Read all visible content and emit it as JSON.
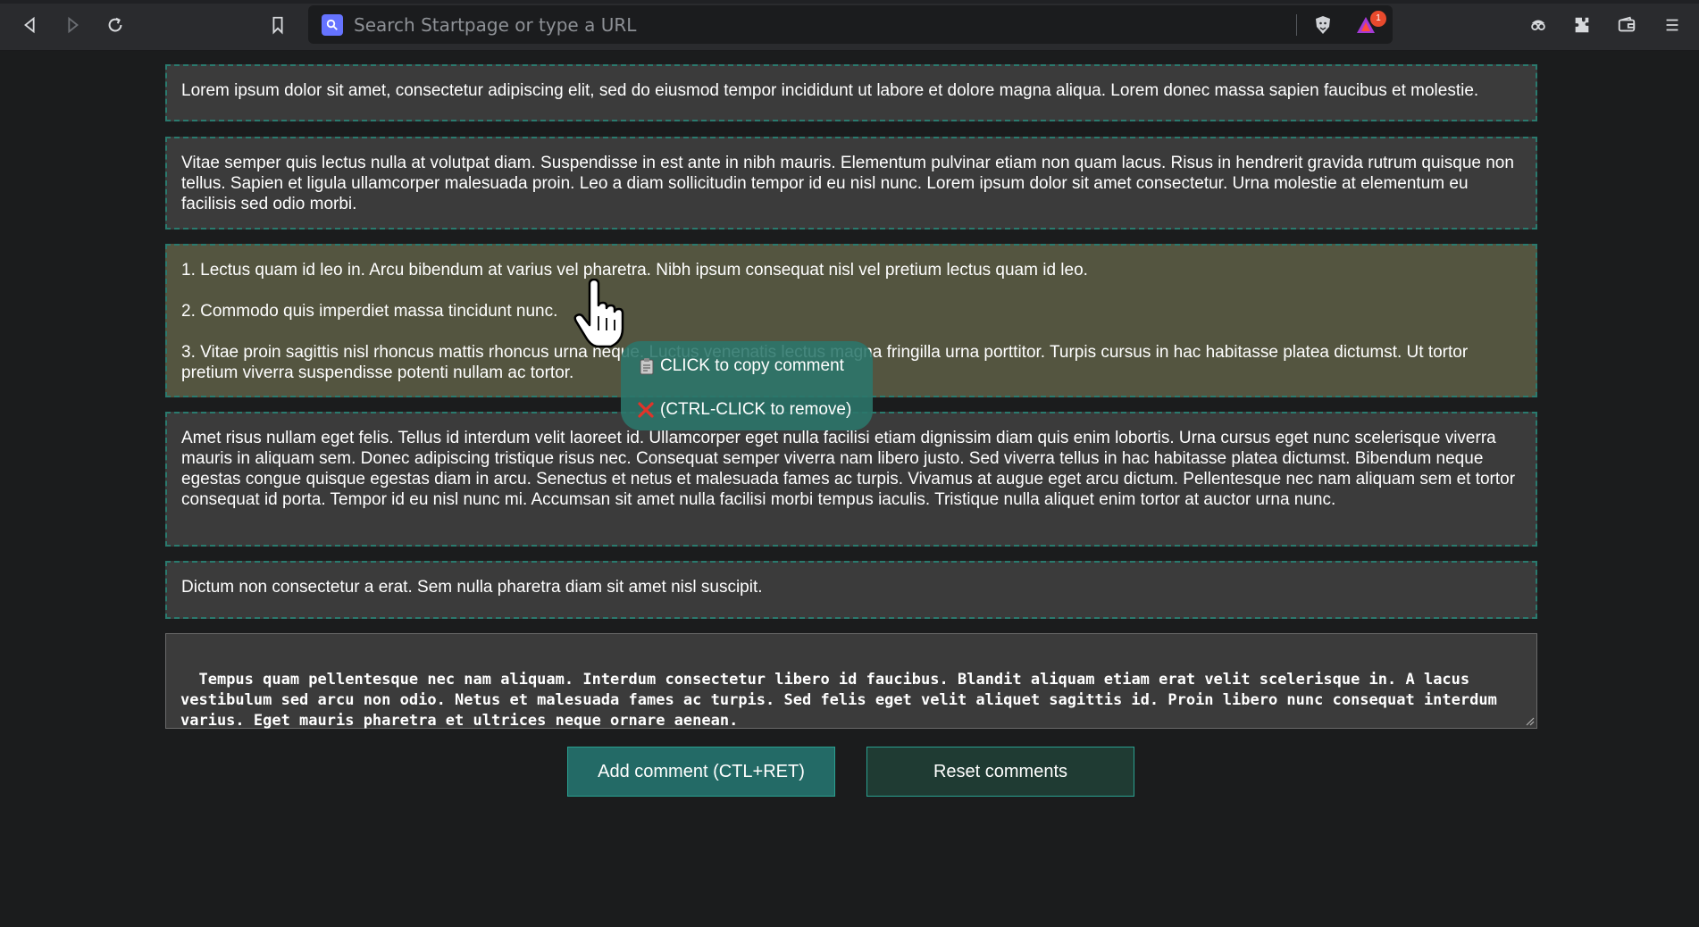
{
  "browser": {
    "url_placeholder": "Search Startpage or type a URL",
    "rewards_badge": "1",
    "icons": [
      "back-icon",
      "forward-icon",
      "reload-icon",
      "bookmark-icon",
      "startpage-search-icon",
      "brave-shields-icon",
      "brave-rewards-icon",
      "tor-private-icon",
      "extensions-icon",
      "wallet-icon",
      "menu-icon"
    ]
  },
  "comments": [
    {
      "paragraphs": [
        "Lorem ipsum dolor sit amet, consectetur adipiscing elit, sed do eiusmod tempor incididunt ut labore et dolore magna aliqua. Lorem donec massa sapien faucibus et molestie."
      ]
    },
    {
      "paragraphs": [
        "Vitae semper quis lectus nulla at volutpat diam. Suspendisse in est ante in nibh mauris. Elementum pulvinar etiam non quam lacus. Risus in hendrerit gravida rutrum quisque non tellus. Sapien et ligula ullamcorper malesuada proin. Leo a diam sollicitudin tempor id eu nisl nunc. Lorem ipsum dolor sit amet consectetur. Urna molestie at elementum eu facilisis sed odio morbi."
      ]
    },
    {
      "paragraphs": [
        "1. Lectus quam id leo in. Arcu bibendum at varius vel pharetra. Nibh ipsum consequat nisl vel pretium lectus quam id leo.",
        "2. Commodo quis imperdiet massa tincidunt nunc.",
        "3. Vitae proin sagittis nisl rhoncus mattis rhoncus urna neque. Luctus venenatis lectus magna fringilla urna porttitor. Turpis cursus in hac habitasse platea dictumst. Ut tortor pretium viverra suspendisse potenti nullam ac tortor."
      ]
    },
    {
      "paragraphs": [
        "Amet risus nullam eget felis. Tellus id interdum velit laoreet id. Ullamcorper eget nulla facilisi etiam dignissim diam quis enim lobortis. Urna cursus eget nunc scelerisque viverra mauris in aliquam sem. Donec adipiscing tristique risus nec. Consequat semper viverra nam libero justo. Sed viverra tellus in hac habitasse platea dictumst. Bibendum neque egestas congue quisque egestas diam in arcu. Senectus et netus et malesuada fames ac turpis. Vivamus at augue eget arcu dictum. Pellentesque nec nam aliquam sem et tortor consequat id porta. Tempor id eu nisl nunc mi. Accumsan sit amet nulla facilisi morbi tempus iaculis. Tristique nulla aliquet enim tortor at auctor urna nunc."
      ]
    },
    {
      "paragraphs": [
        "Dictum non consectetur a erat. Sem nulla pharetra diam sit amet nisl suscipit."
      ]
    }
  ],
  "editor": {
    "value": "Tempus quam pellentesque nec nam aliquam. Interdum consectetur libero id faucibus. Blandit aliquam etiam erat velit scelerisque in. A lacus vestibulum sed arcu non odio. Netus et malesuada fames ac turpis. Sed felis eget velit aliquet sagittis id. Proin libero nunc consequat interdum varius. Eget mauris pharetra et ultrices neque ornare aenean."
  },
  "buttons": {
    "add_label": "Add comment (CTL+RET)",
    "reset_label": "Reset comments"
  },
  "tooltip": {
    "copy_label": "CLICK to copy comment",
    "remove_label": "(CTRL-CLICK to remove)"
  },
  "colors": {
    "page_bg": "#1b1c1d",
    "comment_bg": "#3b3b3b",
    "comment_highlight_bg": "#545540",
    "comment_border": "#2a7a6e",
    "add_button_bg": "#236a66",
    "reset_button_bg": "#1f3b33",
    "tooltip_bg": "#2b766b"
  }
}
